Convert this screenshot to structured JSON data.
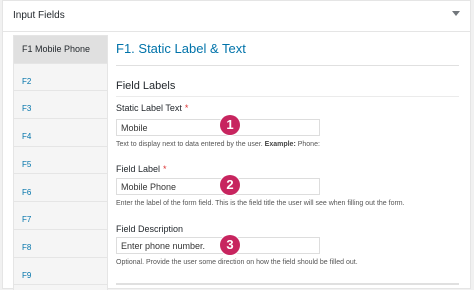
{
  "panel": {
    "title": "Input Fields"
  },
  "tabs": [
    {
      "label": "F1  Mobile Phone",
      "active": true
    },
    {
      "label": "F2"
    },
    {
      "label": "F3"
    },
    {
      "label": "F4"
    },
    {
      "label": "F5"
    },
    {
      "label": "F6"
    },
    {
      "label": "F7"
    },
    {
      "label": "F8"
    },
    {
      "label": "F9"
    }
  ],
  "content": {
    "title": "F1.  Static Label & Text",
    "section_heading": "Field Labels",
    "fields": [
      {
        "label": "Static Label Text",
        "required_mark": "*",
        "value": "Mobile",
        "desc": "Text to display next to data entered by the user.",
        "desc_example": "Example:",
        "desc_example_value": " Phone:",
        "badge": "1"
      },
      {
        "label": "Field Label",
        "required_mark": "*",
        "value": "Mobile Phone",
        "desc": "Enter the label of the form field. This is the field title the user will see when filling out the form.",
        "badge": "2"
      },
      {
        "label": "Field Description",
        "value": "Enter phone number.",
        "desc": "Optional. Provide the user some direction on how the field should be filled out.",
        "badge": "3"
      }
    ]
  },
  "colors": {
    "accent": "#0073aa",
    "badge": "#c7255f",
    "required": "#dc3232"
  }
}
